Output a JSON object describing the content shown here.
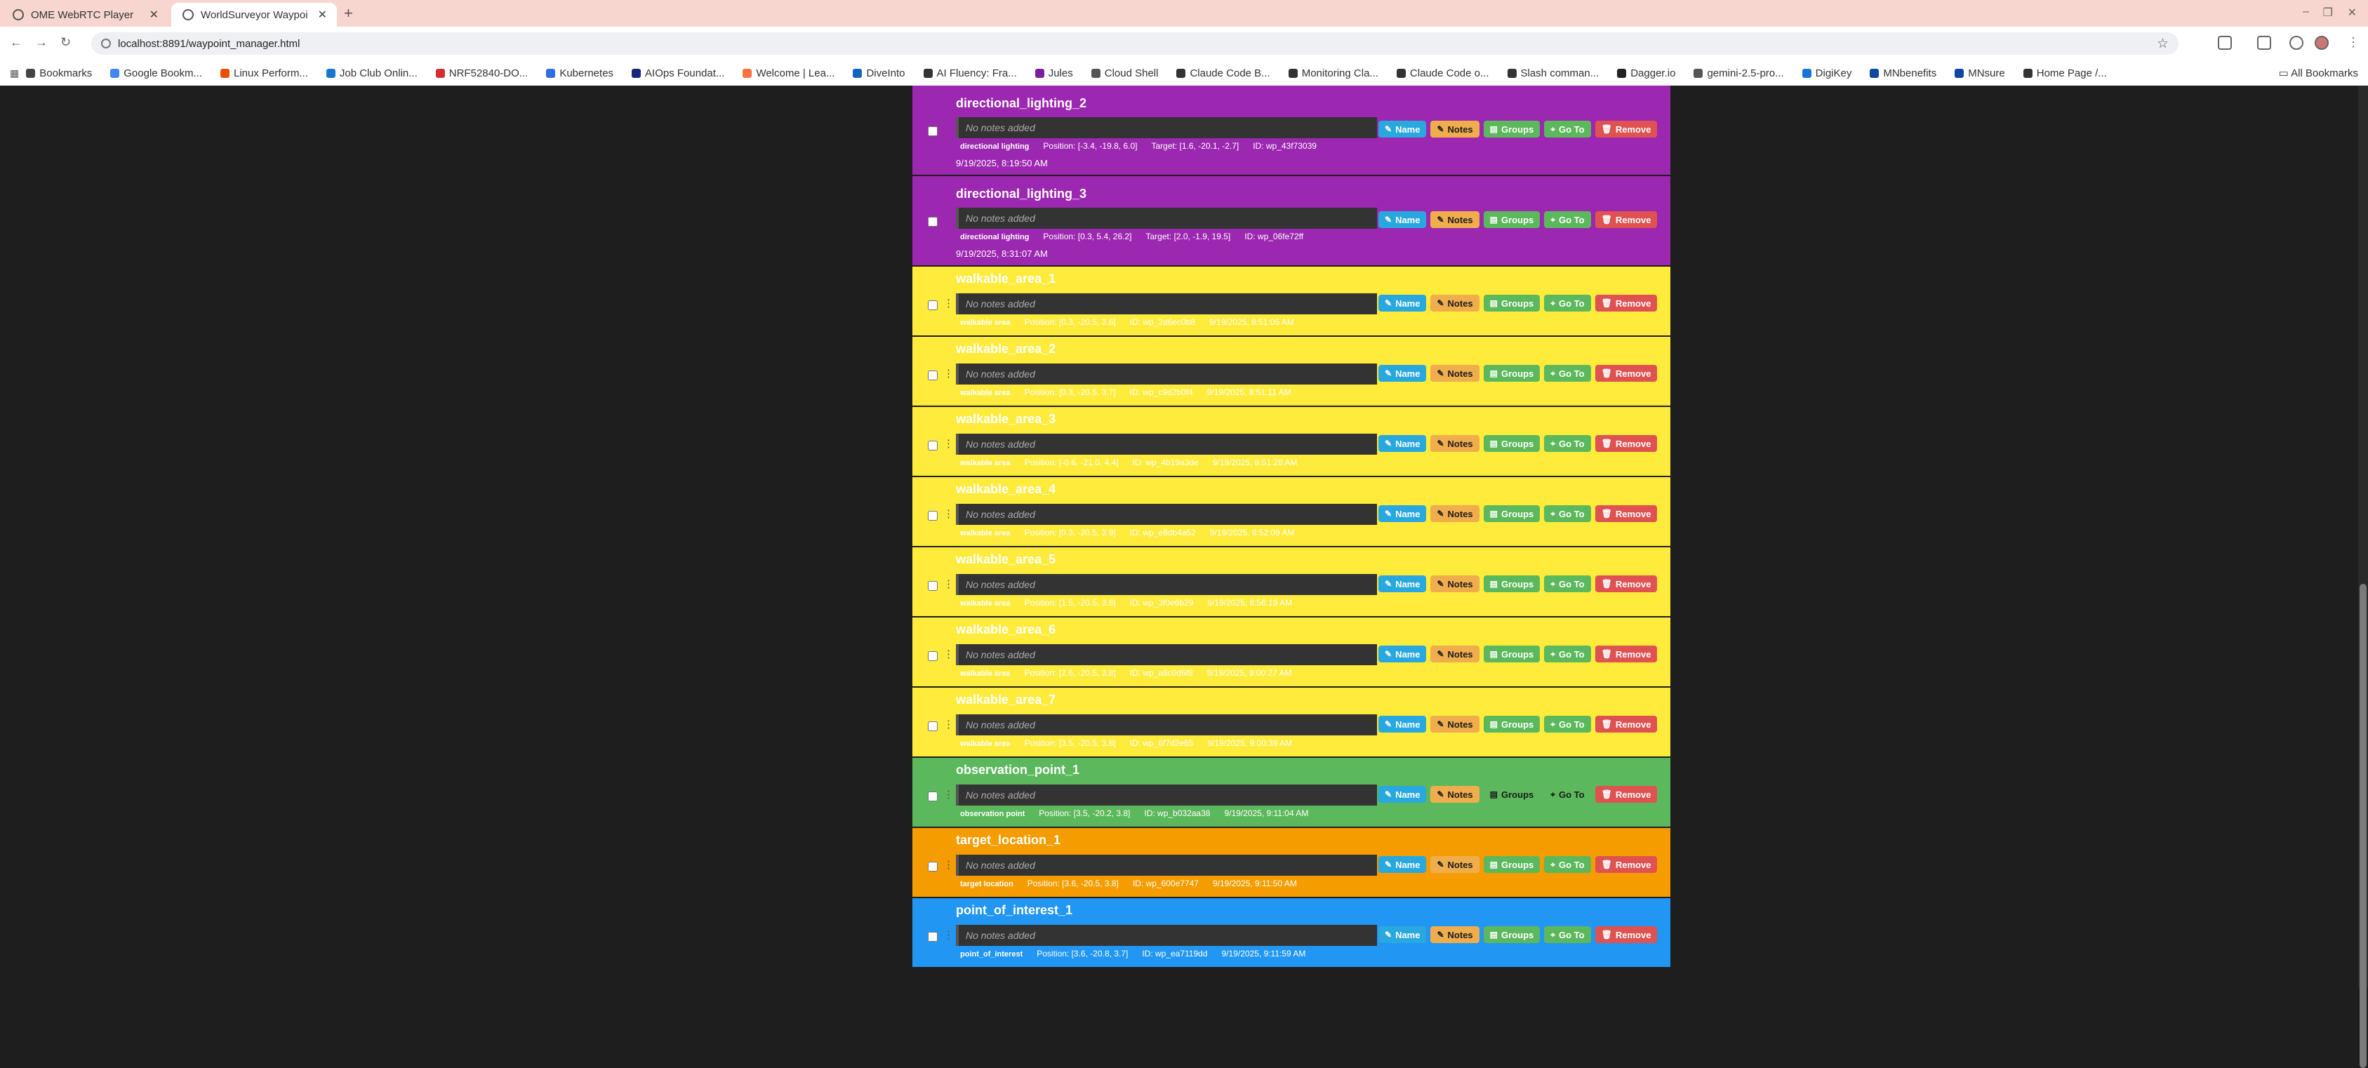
{
  "browser": {
    "tabs": [
      {
        "title": "OME WebRTC Player"
      },
      {
        "title": "WorldSurveyor Waypoi"
      }
    ],
    "url": "localhost:8891/waypoint_manager.html",
    "bookmarks": [
      "Bookmarks",
      "Google Bookm...",
      "Linux Perform...",
      "Job Club Onlin...",
      "NRF52840-DO...",
      "Kubernetes",
      "AIOps Foundat...",
      "Welcome | Lea...",
      "DiveInto",
      "AI Fluency: Fra...",
      "Jules",
      "Cloud Shell",
      "Claude Code B...",
      "Monitoring Cla...",
      "Claude Code o...",
      "Slash comman...",
      "Dagger.io",
      "gemini-2.5-pro...",
      "DigiKey",
      "MNbenefits",
      "MNsure",
      "Home Page /..."
    ],
    "all_bookmarks": "All Bookmarks"
  },
  "buttons": {
    "name": "Name",
    "notes": "Notes",
    "groups": "Groups",
    "goto": "Go To",
    "remove": "Remove"
  },
  "colors": {
    "directional_lighting": "#9c27b0",
    "walkable_area": "#ffeb3b",
    "observation_point": "#5cb85c",
    "target_location": "#f59d00",
    "point_of_interest": "#2196f3"
  },
  "waypoints": [
    {
      "name": "directional_lighting_2",
      "notes": "No notes added",
      "type": "directional lighting",
      "position": "Position: [-3.4, -19.8, 6.0]",
      "target": "Target: [1.6, -20.1, -2.7]",
      "id": "ID: wp_43f73039",
      "date": "9/19/2025, 8:19:50 AM"
    },
    {
      "name": "directional_lighting_3",
      "notes": "No notes added",
      "type": "directional lighting",
      "position": "Position: [0.3, 5.4, 26.2]",
      "target": "Target: [2.0, -1.9, 19.5]",
      "id": "ID: wp_06fe72ff",
      "date": "9/19/2025, 8:31:07 AM"
    },
    {
      "name": "walkable_area_1",
      "notes": "No notes added",
      "type": "walkable area",
      "position": "Position: [0.3, -20.5, 3.6]",
      "id": "ID: wp_2d6ec0b8",
      "date": "9/19/2025, 8:51:05 AM"
    },
    {
      "name": "walkable_area_2",
      "notes": "No notes added",
      "type": "walkable area",
      "position": "Position: [0.3, -20.5, 3.7]",
      "id": "ID: wp_c9d2b0f4",
      "date": "9/19/2025, 8:51:11 AM"
    },
    {
      "name": "walkable_area_3",
      "notes": "No notes added",
      "type": "walkable area",
      "position": "Position: [-0.6, -21.0, 4.4]",
      "id": "ID: wp_4b19a3de",
      "date": "9/19/2025, 8:51:28 AM"
    },
    {
      "name": "walkable_area_4",
      "notes": "No notes added",
      "type": "walkable area",
      "position": "Position: [0.3, -20.5, 3.9]",
      "id": "ID: wp_e8db4a52",
      "date": "9/19/2025, 8:52:09 AM"
    },
    {
      "name": "walkable_area_5",
      "notes": "No notes added",
      "type": "walkable area",
      "position": "Position: [1.5, -20.5, 3.8]",
      "id": "ID: wp_3f0e6b29",
      "date": "9/19/2025, 8:56:19 AM"
    },
    {
      "name": "walkable_area_6",
      "notes": "No notes added",
      "type": "walkable area",
      "position": "Position: [2.6, -20.5, 3.8]",
      "id": "ID: wp_a8c0d6f8",
      "date": "9/19/2025, 9:00:27 AM"
    },
    {
      "name": "walkable_area_7",
      "notes": "No notes added",
      "type": "walkable area",
      "position": "Position: [3.5, -20.5, 3.8]",
      "id": "ID: wp_6f7d2e65",
      "date": "9/19/2025, 9:00:39 AM"
    },
    {
      "name": "observation_point_1",
      "notes": "No notes added",
      "type": "observation point",
      "position": "Position: [3.5, -20.2, 3.8]",
      "id": "ID: wp_b032aa38",
      "date": "9/19/2025, 9:11:04 AM"
    },
    {
      "name": "target_location_1",
      "notes": "No notes added",
      "type": "target location",
      "position": "Position: [3.6, -20.5, 3.8]",
      "id": "ID: wp_600e7747",
      "date": "9/19/2025, 9:11:50 AM"
    },
    {
      "name": "point_of_interest_1",
      "notes": "No notes added",
      "type": "point_of_interest",
      "position": "Position: [3.6, -20.8, 3.7]",
      "id": "ID: wp_ea7119dd",
      "date": "9/19/2025, 9:11:59 AM"
    }
  ]
}
